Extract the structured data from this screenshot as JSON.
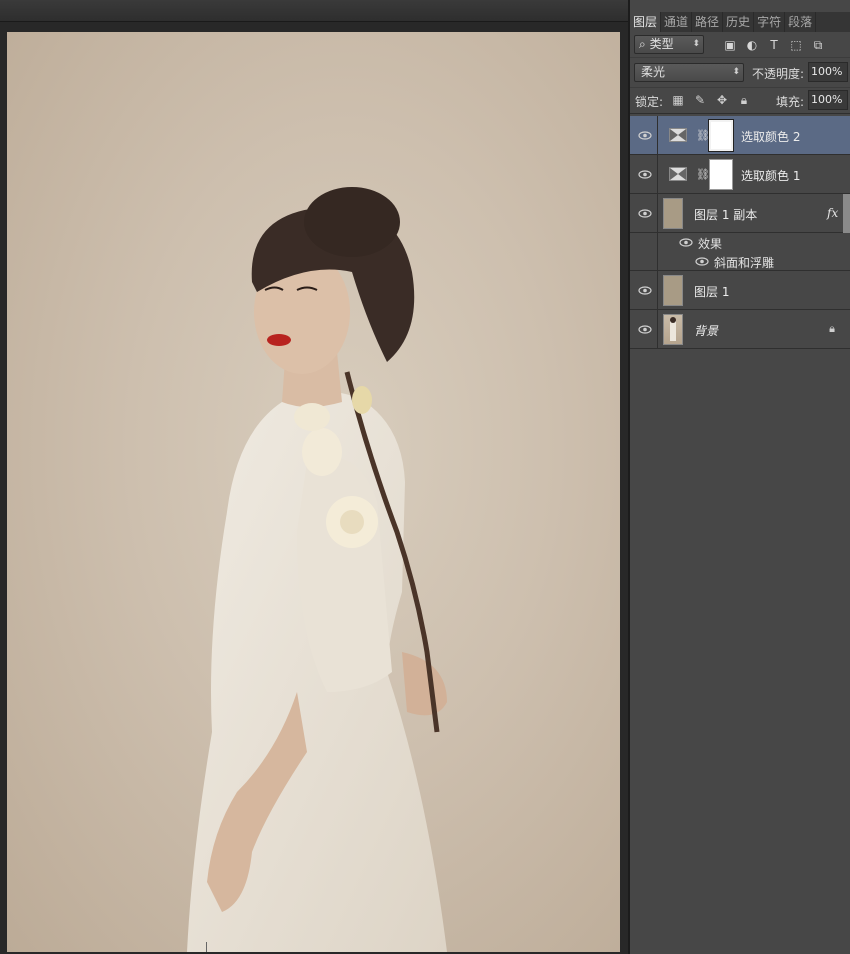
{
  "panel": {
    "tabs": [
      "图层",
      "通道",
      "路径",
      "历史",
      "字符",
      "段落"
    ],
    "filter": {
      "kind_label": "类型",
      "kind_icon": "search-icon",
      "filter_icons": [
        "image-filter-icon",
        "adjustment-filter-icon",
        "type-filter-icon",
        "shape-filter-icon",
        "smart-object-filter-icon"
      ]
    },
    "blend_mode": "柔光",
    "opacity_label": "不透明度:",
    "opacity_value": "100%",
    "lock_label": "锁定:",
    "fill_label": "填充:",
    "fill_value": "100%",
    "layers": [
      {
        "name": "选取颜色 2",
        "type": "adjustment",
        "selected": true,
        "visible": true
      },
      {
        "name": "选取颜色 1",
        "type": "adjustment",
        "selected": false,
        "visible": true
      },
      {
        "name": "图层 1 副本",
        "type": "pixel",
        "thumb_color": "#a89b85",
        "has_fx": true,
        "fx_label": "fx",
        "visible": true,
        "effects": {
          "header": "效果",
          "items": [
            "斜面和浮雕"
          ]
        }
      },
      {
        "name": "图层 1",
        "type": "pixel",
        "thumb_color": "#a89b85",
        "visible": true
      },
      {
        "name": "背景",
        "type": "background",
        "locked": true,
        "visible": true
      }
    ]
  },
  "colors": {
    "panel_bg": "#474747",
    "selected_row": "#5b6a85",
    "canvas_bg": "#282828",
    "photo_bg": "#cdbfae"
  }
}
